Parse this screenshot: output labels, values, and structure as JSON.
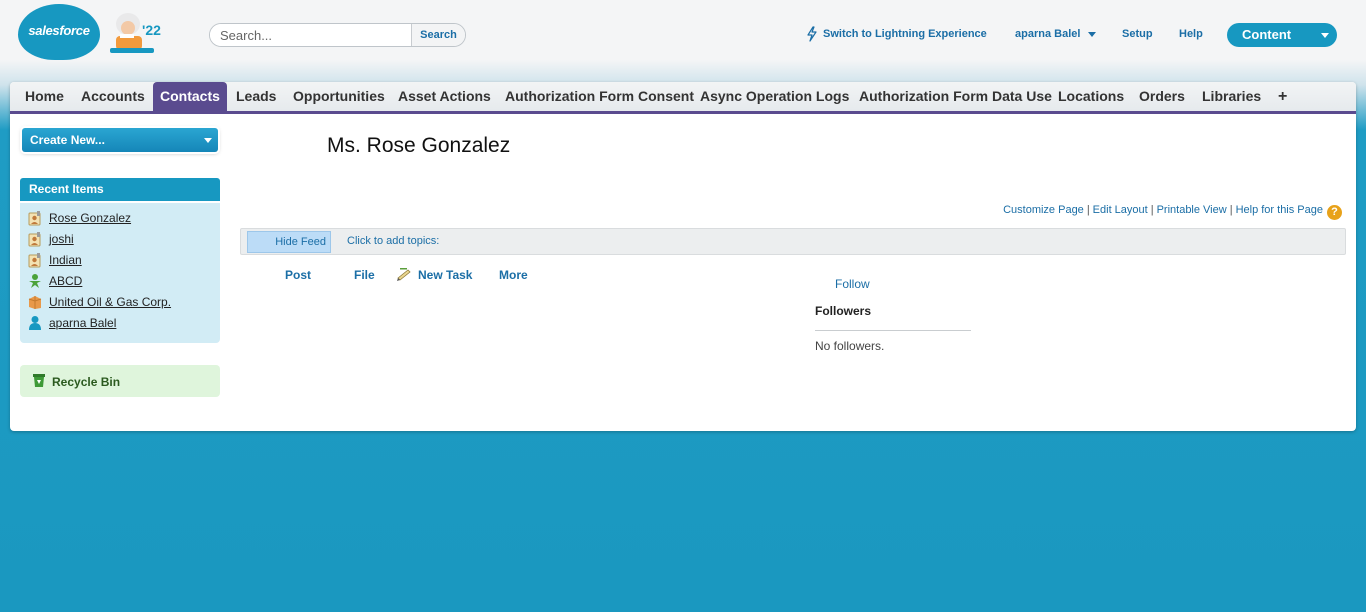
{
  "header": {
    "logo_text": "salesforce",
    "release_badge": "'22",
    "search": {
      "placeholder": "Search...",
      "button_label": "Search"
    },
    "lightning_link": "Switch to Lightning Experience",
    "user_menu": "aparna Balel",
    "setup": "Setup",
    "help": "Help",
    "app_switcher": "Content"
  },
  "tabs": [
    {
      "label": "Home"
    },
    {
      "label": "Accounts"
    },
    {
      "label": "Contacts",
      "active": true
    },
    {
      "label": "Leads"
    },
    {
      "label": "Opportunities"
    },
    {
      "label": "Asset Actions"
    },
    {
      "label": "Authorization Form Consent"
    },
    {
      "label": "Async Operation Logs"
    },
    {
      "label": "Authorization Form Data Use"
    },
    {
      "label": "Locations"
    },
    {
      "label": "Orders"
    },
    {
      "label": "Libraries"
    },
    {
      "label": "+"
    }
  ],
  "sidebar": {
    "create_new": "Create New...",
    "recent_items_title": "Recent Items",
    "recent_items": [
      {
        "label": "Rose Gonzalez",
        "icon": "contact-icon"
      },
      {
        "label": "joshi",
        "icon": "contact-icon"
      },
      {
        "label": "Indian",
        "icon": "contact-icon"
      },
      {
        "label": "ABCD",
        "icon": "lead-icon"
      },
      {
        "label": "United Oil & Gas Corp.",
        "icon": "account-icon"
      },
      {
        "label": "aparna Balel",
        "icon": "user-icon"
      }
    ],
    "recycle_bin": "Recycle Bin"
  },
  "main": {
    "title": "Ms. Rose Gonzalez",
    "page_links": {
      "customize": "Customize Page",
      "edit_layout": "Edit Layout",
      "printable": "Printable View",
      "help": "Help for this Page",
      "help_icon_glyph": "?"
    },
    "feed": {
      "hide_feed": "Hide Feed",
      "add_topics": "Click to add topics:"
    },
    "actions": {
      "post": "Post",
      "file": "File",
      "new_task": "New Task",
      "more": "More"
    },
    "follow": "Follow",
    "followers_title": "Followers",
    "no_followers": "No followers."
  },
  "colors": {
    "brand_blue": "#1798c1",
    "tab_active": "#5a4b8f",
    "link": "#1b6ea6",
    "recent_bg": "#d2ecf5",
    "recycle_bg": "#dff5dc"
  }
}
